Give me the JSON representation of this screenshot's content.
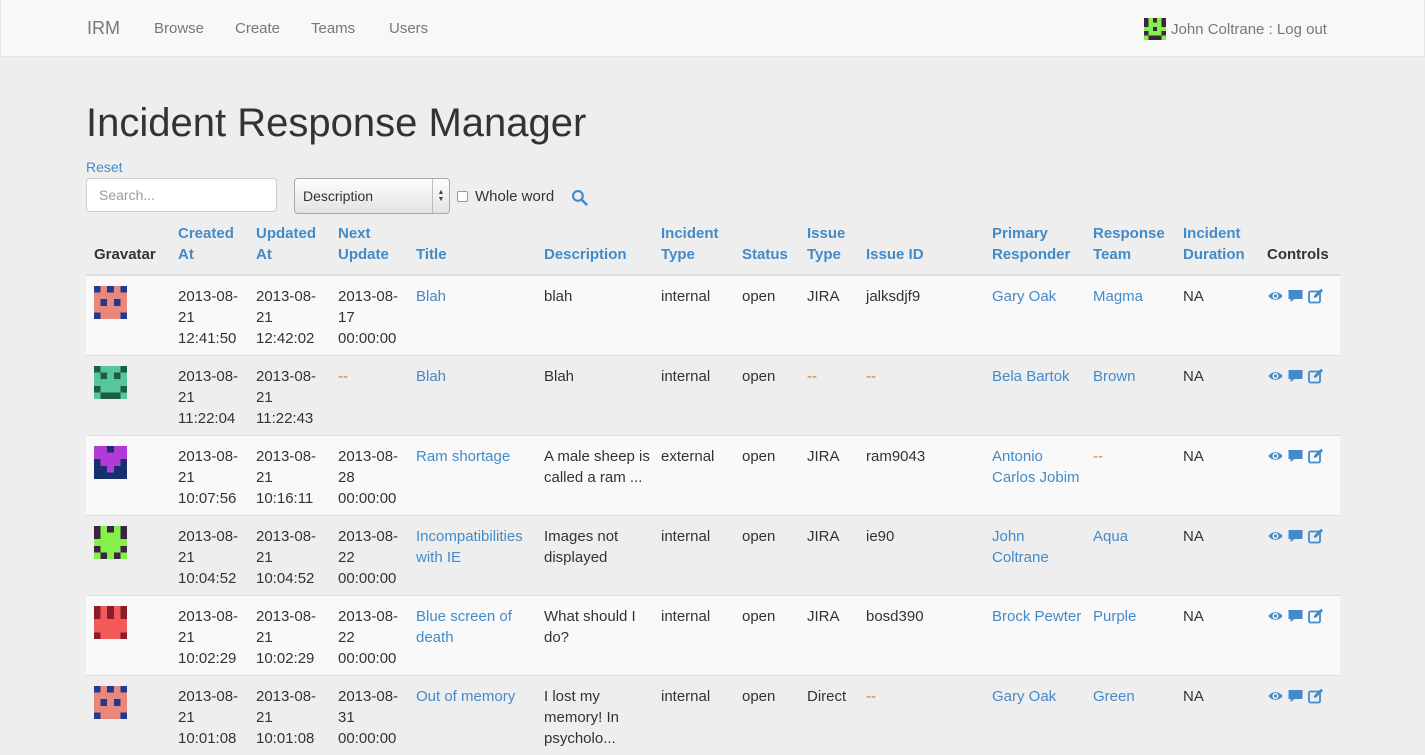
{
  "navbar": {
    "brand": "IRM",
    "items": [
      "Browse",
      "Create",
      "Teams",
      "Users"
    ],
    "user_name": "John Coltrane",
    "separator": " : ",
    "logout": "Log out"
  },
  "page": {
    "title": "Incident Response Manager",
    "reset": "Reset"
  },
  "search": {
    "placeholder": "Search...",
    "field_selected": "Description",
    "whole_word_label": "Whole word"
  },
  "table": {
    "headers": {
      "gravatar": "Gravatar",
      "created_at": "Created At",
      "updated_at": "Updated At",
      "next_update": "Next Update",
      "title": "Title",
      "description": "Description",
      "incident_type": "Incident Type",
      "status": "Status",
      "issue_type": "Issue Type",
      "issue_id": "Issue ID",
      "primary_responder": "Primary Responder",
      "response_team": "Response Team",
      "incident_duration": "Incident Duration",
      "controls": "Controls"
    },
    "rows": [
      {
        "created": "2013-08-21 12:41:50",
        "updated": "2013-08-21 12:42:02",
        "next_update": "2013-08-17 00:00:00",
        "title": "Blah",
        "description": "blah",
        "incident_type": "internal",
        "status": "open",
        "issue_type": "JIRA",
        "issue_id": "jalksdjf9",
        "responder": "Gary Oak",
        "team": "Magma",
        "duration": "NA"
      },
      {
        "created": "2013-08-21 11:22:04",
        "updated": "2013-08-21 11:22:43",
        "next_update": "--",
        "title": "Blah",
        "description": "Blah",
        "incident_type": "internal",
        "status": "open",
        "issue_type": "--",
        "issue_id": "--",
        "responder": "Bela Bartok",
        "team": "Brown",
        "duration": "NA"
      },
      {
        "created": "2013-08-21 10:07:56",
        "updated": "2013-08-21 10:16:11",
        "next_update": "2013-08-28 00:00:00",
        "title": "Ram shortage",
        "description": "A male sheep is called a ram ...",
        "incident_type": "external",
        "status": "open",
        "issue_type": "JIRA",
        "issue_id": "ram9043",
        "responder": "Antonio Carlos Jobim",
        "team": "--",
        "duration": "NA"
      },
      {
        "created": "2013-08-21 10:04:52",
        "updated": "2013-08-21 10:04:52",
        "next_update": "2013-08-22 00:00:00",
        "title": "Incompatibilities with IE",
        "description": "Images not displayed",
        "incident_type": "internal",
        "status": "open",
        "issue_type": "JIRA",
        "issue_id": "ie90",
        "responder": "John Coltrane",
        "team": "Aqua",
        "duration": "NA"
      },
      {
        "created": "2013-08-21 10:02:29",
        "updated": "2013-08-21 10:02:29",
        "next_update": "2013-08-22 00:00:00",
        "title": "Blue screen of death",
        "description": "What should I do?",
        "incident_type": "internal",
        "status": "open",
        "issue_type": "JIRA",
        "issue_id": "bosd390",
        "responder": "Brock Pewter",
        "team": "Purple",
        "duration": "NA"
      },
      {
        "created": "2013-08-21 10:01:08",
        "updated": "2013-08-21 10:01:08",
        "next_update": "2013-08-31 00:00:00",
        "title": "Out of memory",
        "description": "I lost my memory! In psycholo...",
        "incident_type": "internal",
        "status": "open",
        "issue_type": "Direct",
        "issue_id": "--",
        "responder": "Gary Oak",
        "team": "Green",
        "duration": "NA"
      }
    ]
  },
  "icons": {
    "view": "eye-icon",
    "comment": "comment-icon",
    "edit": "edit-icon",
    "search": "search-icon"
  },
  "colors": {
    "link": "#428bca",
    "dash": "#c87f3a",
    "navbar_bg": "#f8f8f8",
    "page_bg": "#eeeeee"
  }
}
